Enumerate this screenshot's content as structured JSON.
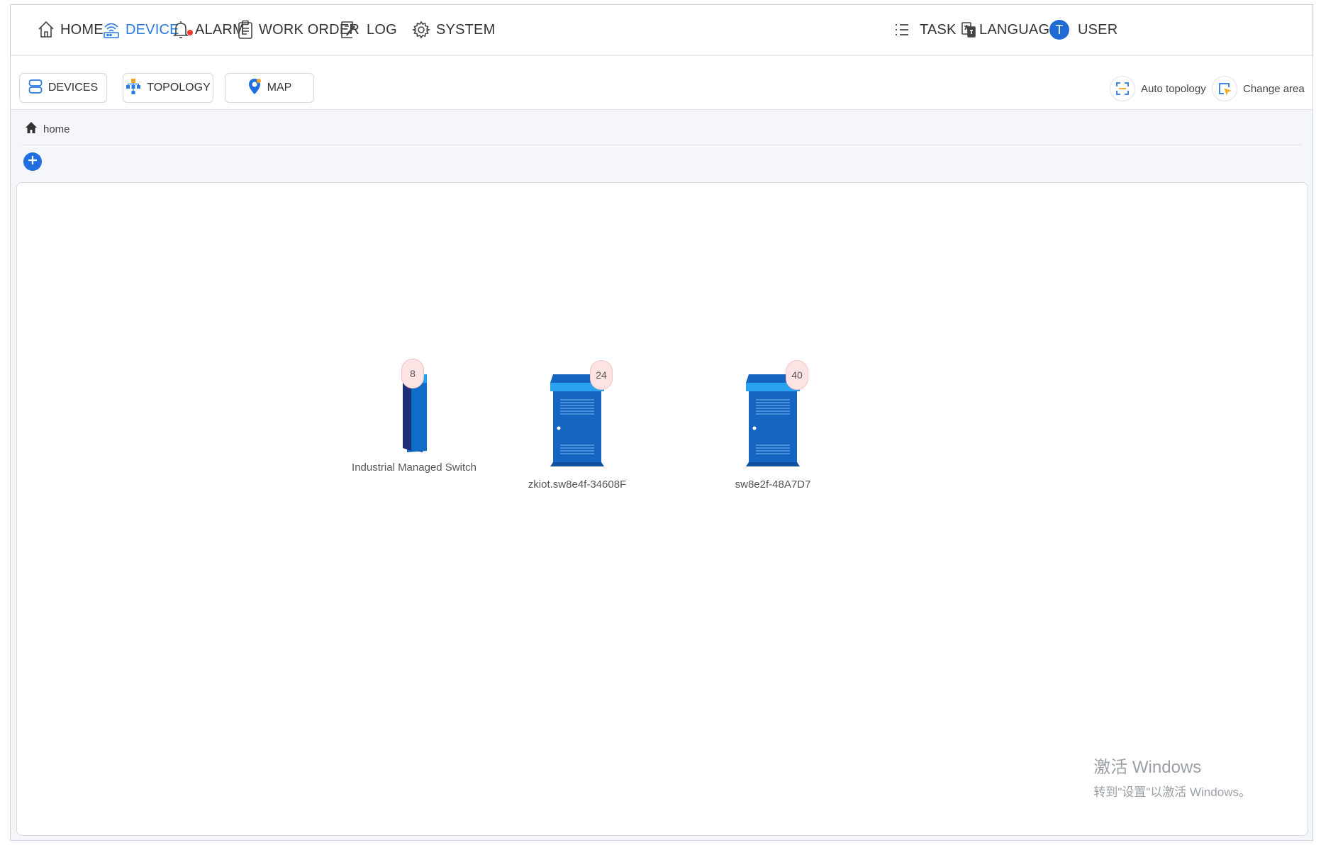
{
  "nav": {
    "home": "HOME",
    "device": "DEVICE",
    "alarm": "ALARM",
    "work_order": "WORK ORDER",
    "log": "LOG",
    "system": "SYSTEM",
    "task": "TASK",
    "language": "LANGUAGE",
    "user": "USER",
    "user_initial": "T"
  },
  "subnav": {
    "devices": "DEVICES",
    "topology": "TOPOLOGY",
    "map": "MAP",
    "auto_topology": "Auto topology",
    "change_area": "Change area"
  },
  "breadcrumb": {
    "home": "home"
  },
  "topology": {
    "nodes": [
      {
        "name": "Industrial Managed Switch",
        "badge": "8",
        "icon": "switch-icon"
      },
      {
        "name": "zkiot.sw8e4f-34608F",
        "badge": "24",
        "icon": "cabinet-icon"
      },
      {
        "name": "sw8e2f-48A7D7",
        "badge": "40",
        "icon": "cabinet-icon"
      }
    ]
  },
  "watermark": {
    "line1": "激活 Windows",
    "line2": "转到\"设置\"以激活 Windows。"
  },
  "colors": {
    "accent": "#2a7ae2",
    "alarm_dot": "#e83a30",
    "badge_bg": "#fde3e3",
    "device_blue": "#1565c0"
  }
}
